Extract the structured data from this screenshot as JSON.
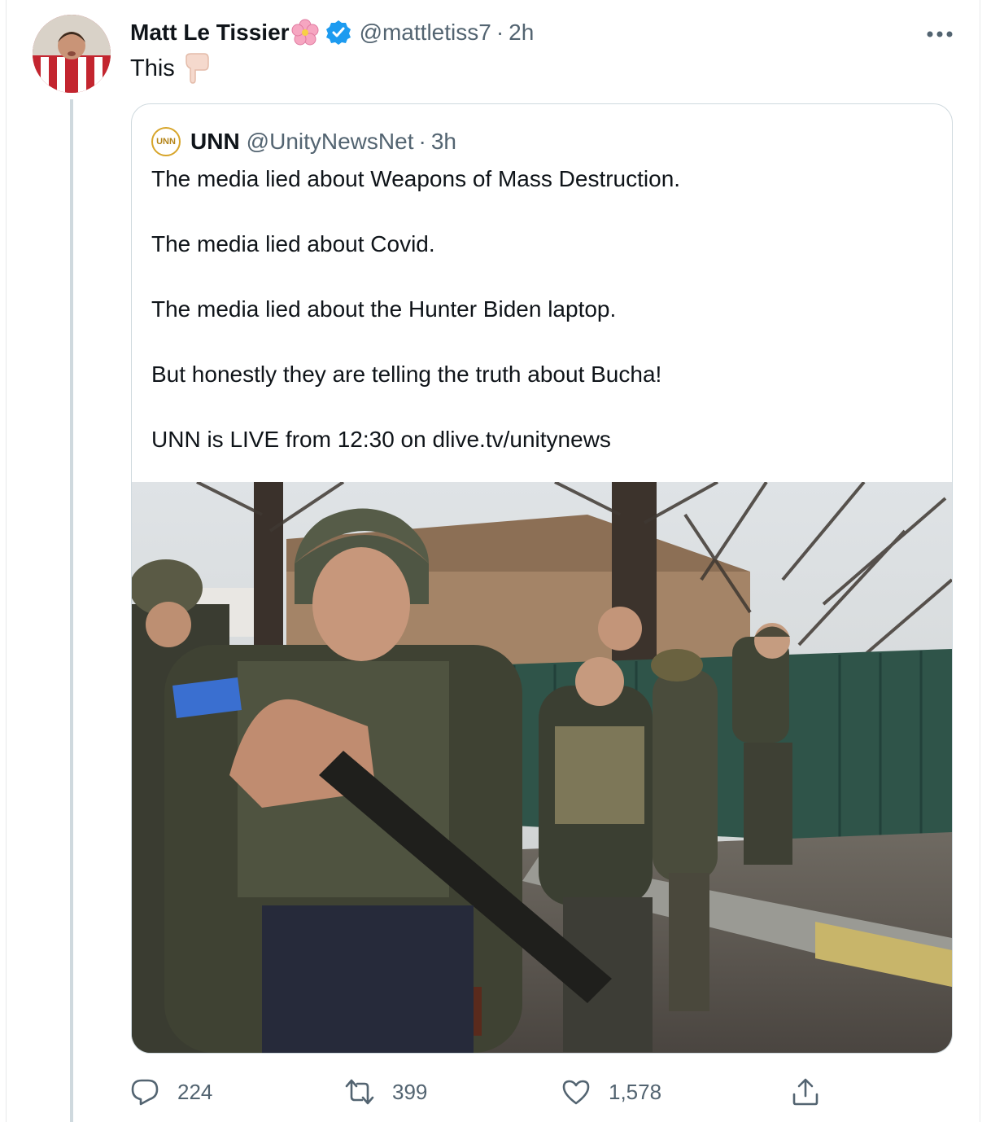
{
  "tweet": {
    "author_name": "Matt Le Tissier",
    "author_handle": "@mattletiss7",
    "separator": "·",
    "time": "2h",
    "text": "This"
  },
  "quoted_tweet": {
    "author_name": "UNN",
    "avatar_text": "UNN",
    "author_handle": "@UnityNewsNet",
    "separator": "·",
    "time": "3h",
    "lines": [
      "The media lied about Weapons of Mass Destruction.",
      "The media lied about Covid.",
      "The media lied about the Hunter Biden laptop.",
      "But honestly they are telling the truth about Bucha!",
      "UNN is LIVE from 12:30 on dlive.tv/unitynews"
    ],
    "image_alt": "photo-soldiers-and-officials-walking"
  },
  "actions": {
    "replies": "224",
    "retweets": "399",
    "likes": "1,578"
  },
  "icons": {
    "verified": "verified-badge-icon",
    "flower": "cherry-blossom-emoji",
    "point": "backhand-index-pointing-down-emoji",
    "more": "more-horizontal-icon",
    "reply": "reply-icon",
    "retweet": "retweet-icon",
    "like": "heart-icon",
    "share": "share-icon"
  },
  "colors": {
    "verified": "#1d9bf0",
    "secondary_text": "#536471",
    "border": "#cfd9de"
  }
}
